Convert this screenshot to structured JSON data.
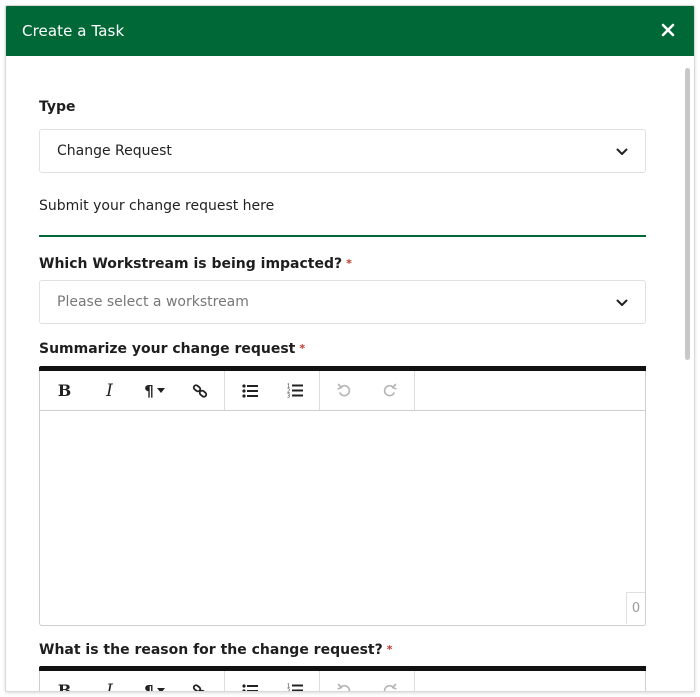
{
  "dialog": {
    "title": "Create a Task",
    "close_icon": "close-icon"
  },
  "form": {
    "type": {
      "label": "Type",
      "value": "Change Request"
    },
    "helper_text": "Submit your change request here",
    "workstream": {
      "label": "Which Workstream is being impacted?",
      "required_marker": "*",
      "placeholder": "Please select a workstream"
    },
    "summary": {
      "label": "Summarize your change request",
      "required_marker": "*",
      "char_count": "0"
    },
    "reason": {
      "label": "What is the reason for the change request?",
      "required_marker": "*"
    }
  },
  "toolbar": {
    "bold": "B",
    "italic": "I",
    "paragraph": "¶",
    "icons": [
      "bold-icon",
      "italic-icon",
      "paragraph-format-icon",
      "link-icon",
      "bullet-list-icon",
      "numbered-list-icon",
      "undo-icon",
      "redo-icon"
    ]
  },
  "colors": {
    "header_bg": "#006837",
    "divider": "#006837",
    "required": "#c0392b"
  }
}
